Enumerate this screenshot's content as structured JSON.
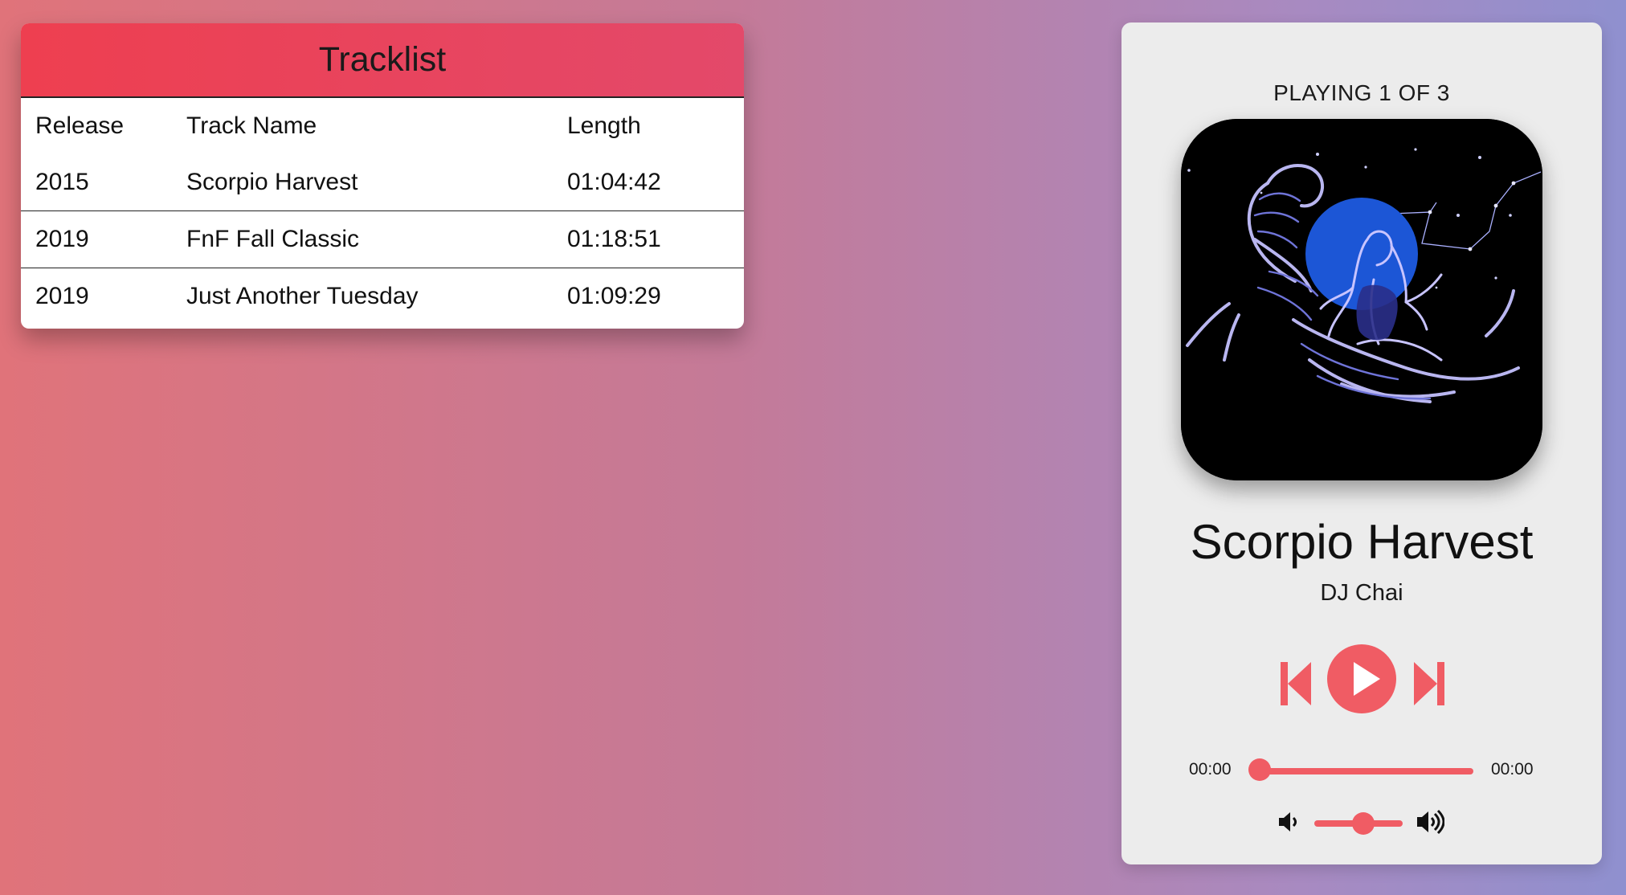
{
  "tracklist": {
    "title": "Tracklist",
    "columns": [
      "Release",
      "Track Name",
      "Length"
    ],
    "rows": [
      {
        "release": "2015",
        "name": "Scorpio Harvest",
        "length": "01:04:42"
      },
      {
        "release": "2019",
        "name": "FnF Fall Classic",
        "length": "01:18:51"
      },
      {
        "release": "2019",
        "name": "Just Another Tuesday",
        "length": "01:09:29"
      }
    ]
  },
  "player": {
    "status": "PLAYING 1 OF 3",
    "track_title": "Scorpio Harvest",
    "artist": "DJ Chai",
    "time_current": "00:00",
    "time_total": "00:00",
    "progress": 0,
    "volume": 0.55,
    "album_art_alt": "scorpio-album-art"
  },
  "colors": {
    "accent": "#f05c64",
    "header_red": "#ee3f50",
    "card_bg": "#ececec",
    "moon_blue": "#1c56d6",
    "figure_lavender": "#b9b6f0"
  },
  "icons": {
    "previous": "skip-previous-icon",
    "play": "play-icon",
    "next": "skip-next-icon",
    "volume_down": "volume-down-icon",
    "volume_up": "volume-up-icon"
  }
}
